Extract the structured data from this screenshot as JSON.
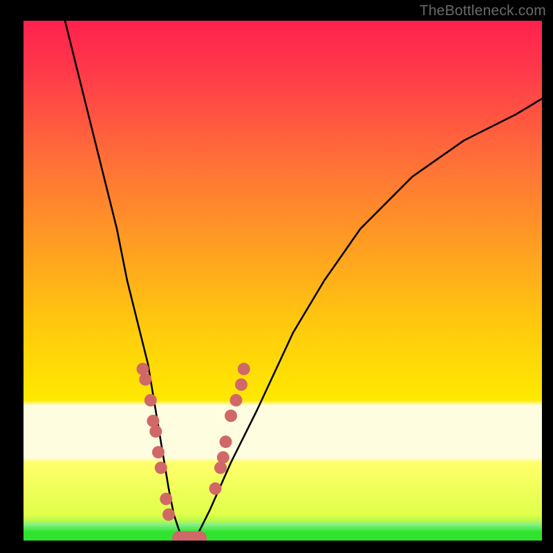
{
  "watermark": "TheBottleneck.com",
  "colors": {
    "page_bg": "#000000",
    "axis": "#000000",
    "curve": "#000000",
    "marker_fill": "#d06868",
    "band_green": "#36e836",
    "band_yellowgreen": "#fffef0",
    "watermark": "#6a6a6a"
  },
  "chart_data": {
    "type": "line",
    "title": "",
    "xlabel": "",
    "ylabel": "",
    "xlim": [
      0,
      100
    ],
    "ylim": [
      0,
      100
    ],
    "legend": false,
    "grid": false,
    "background": "vertical gradient top (#ff2550) to mid (#ffd000) to green band near bottom",
    "series": [
      {
        "name": "bottleneck-curve",
        "x": [
          8,
          12,
          15,
          18,
          20,
          22,
          24,
          25,
          26,
          27,
          28,
          29,
          30,
          31,
          32,
          33,
          34,
          36,
          40,
          45,
          52,
          58,
          65,
          75,
          85,
          95,
          100
        ],
        "y": [
          100,
          84,
          72,
          60,
          50,
          42,
          34,
          28,
          22,
          16,
          10,
          5,
          2,
          0,
          0,
          0,
          2,
          6,
          15,
          25,
          40,
          50,
          60,
          70,
          77,
          82,
          85
        ]
      },
      {
        "name": "highlight-dots-left",
        "x": [
          23,
          23.5,
          24.5,
          25,
          25.5,
          26,
          26.5,
          27.5,
          28
        ],
        "y": [
          33,
          31,
          27,
          23,
          21,
          17,
          14,
          8,
          5
        ]
      },
      {
        "name": "highlight-dots-bottom",
        "x": [
          30,
          31,
          32,
          33,
          34
        ],
        "y": [
          0.5,
          0.5,
          0.5,
          0.5,
          0.5
        ]
      },
      {
        "name": "highlight-dots-right",
        "x": [
          37,
          38,
          38.5,
          39,
          40,
          41,
          42,
          42.5
        ],
        "y": [
          10,
          14,
          16,
          19,
          24,
          27,
          30,
          33
        ]
      }
    ]
  }
}
